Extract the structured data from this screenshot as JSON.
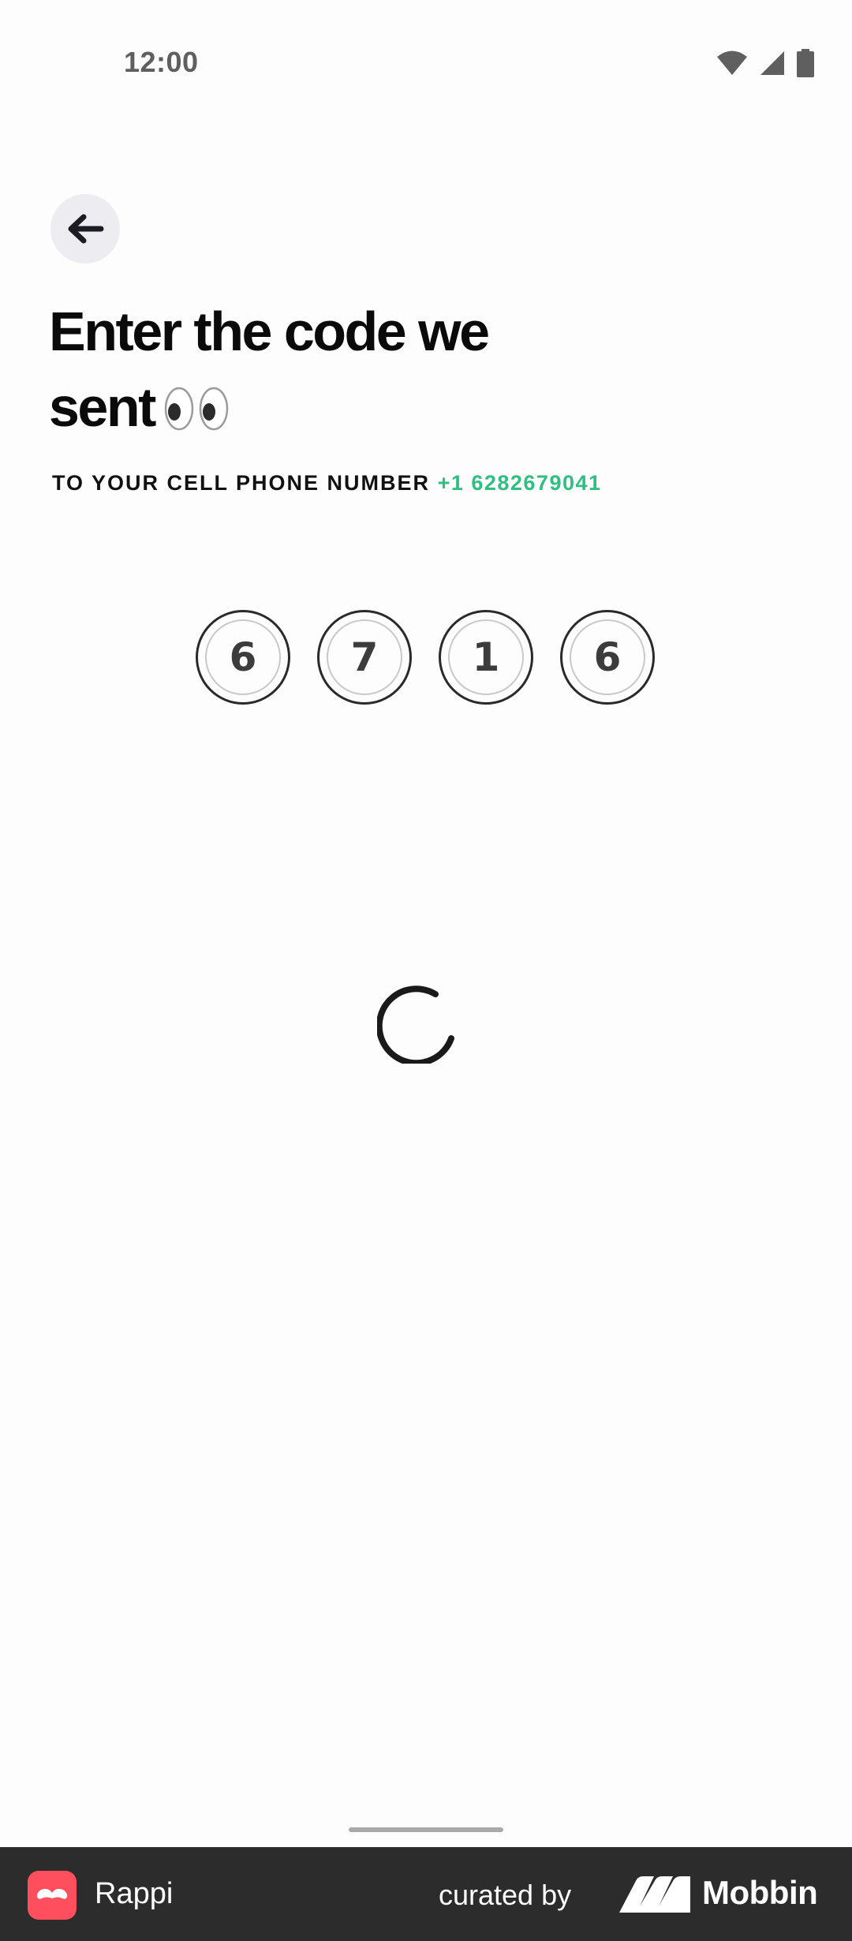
{
  "status_bar": {
    "time": "12:00",
    "icons": [
      "wifi-icon",
      "cellular-signal-icon",
      "battery-icon"
    ]
  },
  "header": {
    "back_icon": "arrow-left-icon"
  },
  "title": {
    "line1": "Enter the code we",
    "line2": "sent",
    "emoji": "eyes-emoji"
  },
  "subtitle": {
    "text": "TO YOUR CELL PHONE NUMBER",
    "phone": "+1 6282679041"
  },
  "code": {
    "digits": [
      "6",
      "7",
      "1",
      "6"
    ]
  },
  "loading": {
    "indicator": "spinner-icon"
  },
  "footer": {
    "app_name": "Rappi",
    "curated_by": "curated by",
    "brand": "Mobbin"
  },
  "colors": {
    "accent_phone": "#2fbf83",
    "footer_bg": "#2c2c2c",
    "app_icon_bg": "#ff4f5e"
  }
}
